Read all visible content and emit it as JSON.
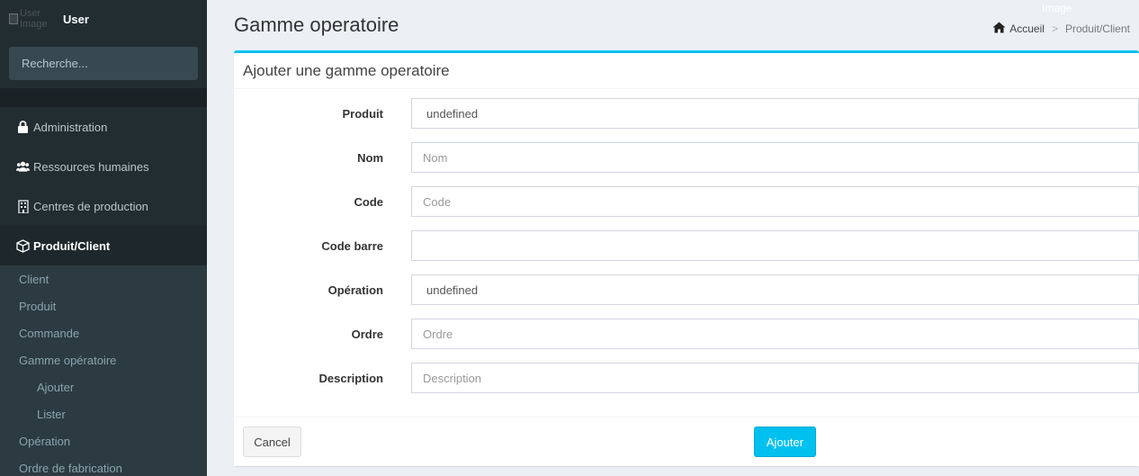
{
  "sidebar": {
    "user_name": "User",
    "avatar_alt": "User Image",
    "search_placeholder": "Recherche...",
    "menu": [
      {
        "label": "Administration",
        "icon": "lock-icon"
      },
      {
        "label": "Ressources humaines",
        "icon": "users-icon"
      },
      {
        "label": "Centres de production",
        "icon": "building-icon"
      },
      {
        "label": "Produit/Client",
        "icon": "cube-icon",
        "active": true
      }
    ],
    "submenu": [
      {
        "label": "Client"
      },
      {
        "label": "Produit"
      },
      {
        "label": "Commande"
      },
      {
        "label": "Gamme opératoire"
      },
      {
        "label": "Ajouter",
        "level": 2
      },
      {
        "label": "Lister",
        "level": 2
      },
      {
        "label": "Opération"
      },
      {
        "label": "Ordre de fabrication"
      }
    ]
  },
  "header": {
    "title": "Gamme operatoire",
    "image_alt": "Image",
    "breadcrumb": {
      "home": "Accueil",
      "current": "Produit/Client"
    }
  },
  "form": {
    "title": "Ajouter une gamme operatoire",
    "fields": [
      {
        "label": "Produit",
        "value": "undefined"
      },
      {
        "label": "Nom",
        "placeholder": "Nom"
      },
      {
        "label": "Code",
        "placeholder": "Code"
      },
      {
        "label": "Code barre",
        "value": ""
      },
      {
        "label": "Opération",
        "value": "undefined"
      },
      {
        "label": "Ordre",
        "placeholder": "Ordre"
      },
      {
        "label": "Description",
        "placeholder": "Description"
      }
    ],
    "cancel_label": "Cancel",
    "submit_label": "Ajouter"
  },
  "colors": {
    "sidebar_bg": "#222d32",
    "accent": "#00c0ef",
    "content_bg": "#ecf0f5"
  }
}
